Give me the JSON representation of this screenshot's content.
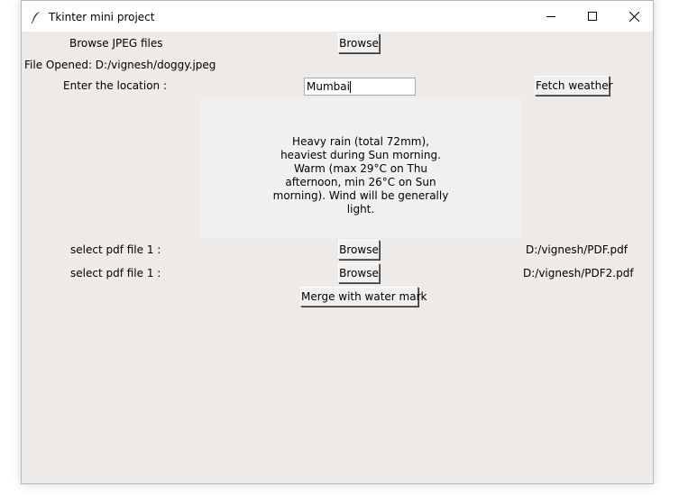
{
  "window": {
    "title": "Tkinter mini project",
    "controls": [
      "minimize-icon",
      "maximize-icon",
      "close-icon"
    ]
  },
  "jpeg": {
    "label": "Browse JPEG files",
    "button": "Browse",
    "opened": "File Opened: D:/vignesh/doggy.jpeg"
  },
  "location": {
    "label": "Enter the location :",
    "value": "Mumbai",
    "button": "Fetch weather"
  },
  "weather": {
    "text": "Heavy rain (total 72mm), heaviest during Sun morning. Warm (max 29°C on Thu afternoon, min 26°C on Sun morning). Wind will be generally light."
  },
  "pdf": {
    "row1": {
      "label": "select pdf file 1 :",
      "button": "Browse",
      "path": "D:/vignesh/PDF.pdf"
    },
    "row2": {
      "label": "select pdf file 1 :",
      "button": "Browse",
      "path": "D:/vignesh/PDF2.pdf"
    },
    "merge_button": "Merge with water mark"
  }
}
